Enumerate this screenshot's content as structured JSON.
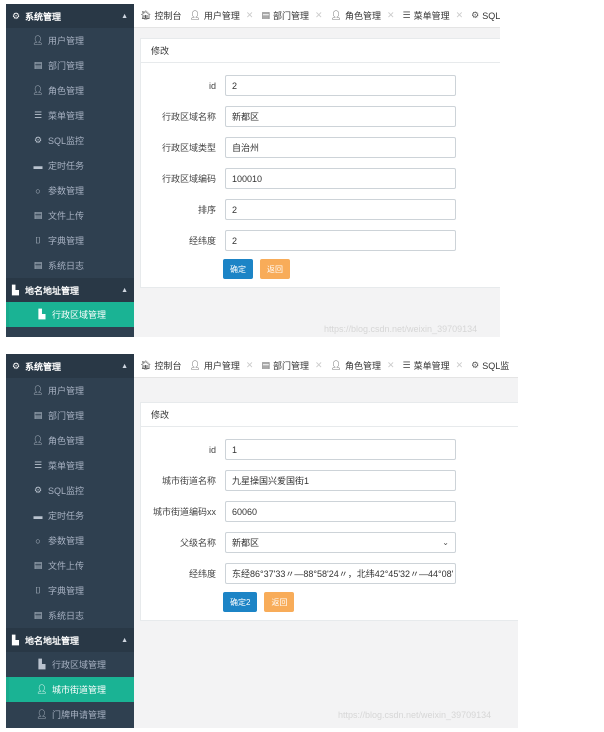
{
  "tabs": [
    {
      "icon": "home-icon",
      "glyph": "🏠︎",
      "label": "控制台"
    },
    {
      "icon": "user-icon",
      "glyph": "👤︎",
      "label": "用户管理"
    },
    {
      "icon": "file-icon",
      "glyph": "▤",
      "label": "部门管理"
    },
    {
      "icon": "user-icon",
      "glyph": "👤︎",
      "label": "角色管理"
    },
    {
      "icon": "list-icon",
      "glyph": "☰",
      "label": "菜单管理"
    },
    {
      "icon": "sql-icon",
      "glyph": "⚙",
      "label": "SQL监"
    }
  ],
  "sidebar": {
    "system_title": "系统管理",
    "system_items": [
      {
        "icon": "user-icon",
        "glyph": "👤︎",
        "label": "用户管理"
      },
      {
        "icon": "file-icon",
        "glyph": "▤",
        "label": "部门管理"
      },
      {
        "icon": "user-icon",
        "glyph": "👤︎",
        "label": "角色管理"
      },
      {
        "icon": "list-icon",
        "glyph": "☰",
        "label": "菜单管理"
      },
      {
        "icon": "gear-icon",
        "glyph": "⚙",
        "label": "SQL监控"
      },
      {
        "icon": "task-icon",
        "glyph": "▬",
        "label": "定时任务"
      },
      {
        "icon": "circle-icon",
        "glyph": "○",
        "label": "参数管理"
      },
      {
        "icon": "upload-icon",
        "glyph": "▤",
        "label": "文件上传"
      },
      {
        "icon": "bookmark-icon",
        "glyph": "⌷",
        "label": "字典管理"
      },
      {
        "icon": "log-icon",
        "glyph": "▤",
        "label": "系统日志"
      }
    ],
    "address_title": "地名地址管理",
    "address_items": [
      {
        "icon": "chart-icon",
        "glyph": "▙",
        "label": "行政区域管理"
      },
      {
        "icon": "user-icon",
        "glyph": "👤︎",
        "label": "城市街道管理"
      },
      {
        "icon": "user-icon",
        "glyph": "👤︎",
        "label": "门牌申请管理"
      }
    ]
  },
  "form1": {
    "title": "修改",
    "fields": [
      {
        "label": "id",
        "value": "2"
      },
      {
        "label": "行政区域名称",
        "value": "新都区"
      },
      {
        "label": "行政区域类型",
        "value": "自治州"
      },
      {
        "label": "行政区域编码",
        "value": "100010"
      },
      {
        "label": "排序",
        "value": "2"
      },
      {
        "label": "经纬度",
        "value": "2"
      }
    ],
    "confirm": "确定",
    "back": "返回"
  },
  "form2": {
    "title": "修改",
    "fields": [
      {
        "label": "id",
        "value": "1"
      },
      {
        "label": "城市街道名称",
        "value": "九星操国兴爱国街1"
      },
      {
        "label": "城市街道编码xx",
        "value": "60060"
      },
      {
        "label": "父级名称",
        "value": "新都区"
      },
      {
        "label": "经纬度",
        "value": "东经86°37'33〃—88°58'24〃，北纬42°45'32〃—44°08'"
      }
    ],
    "confirm": "确定2",
    "back": "返回"
  },
  "watermark": "https://blog.csdn.net/weixin_39709134",
  "colors": {
    "sidebar": "#2f4050",
    "active": "#1ab394",
    "primary": "#1c84c6",
    "warning": "#f8ac59"
  }
}
